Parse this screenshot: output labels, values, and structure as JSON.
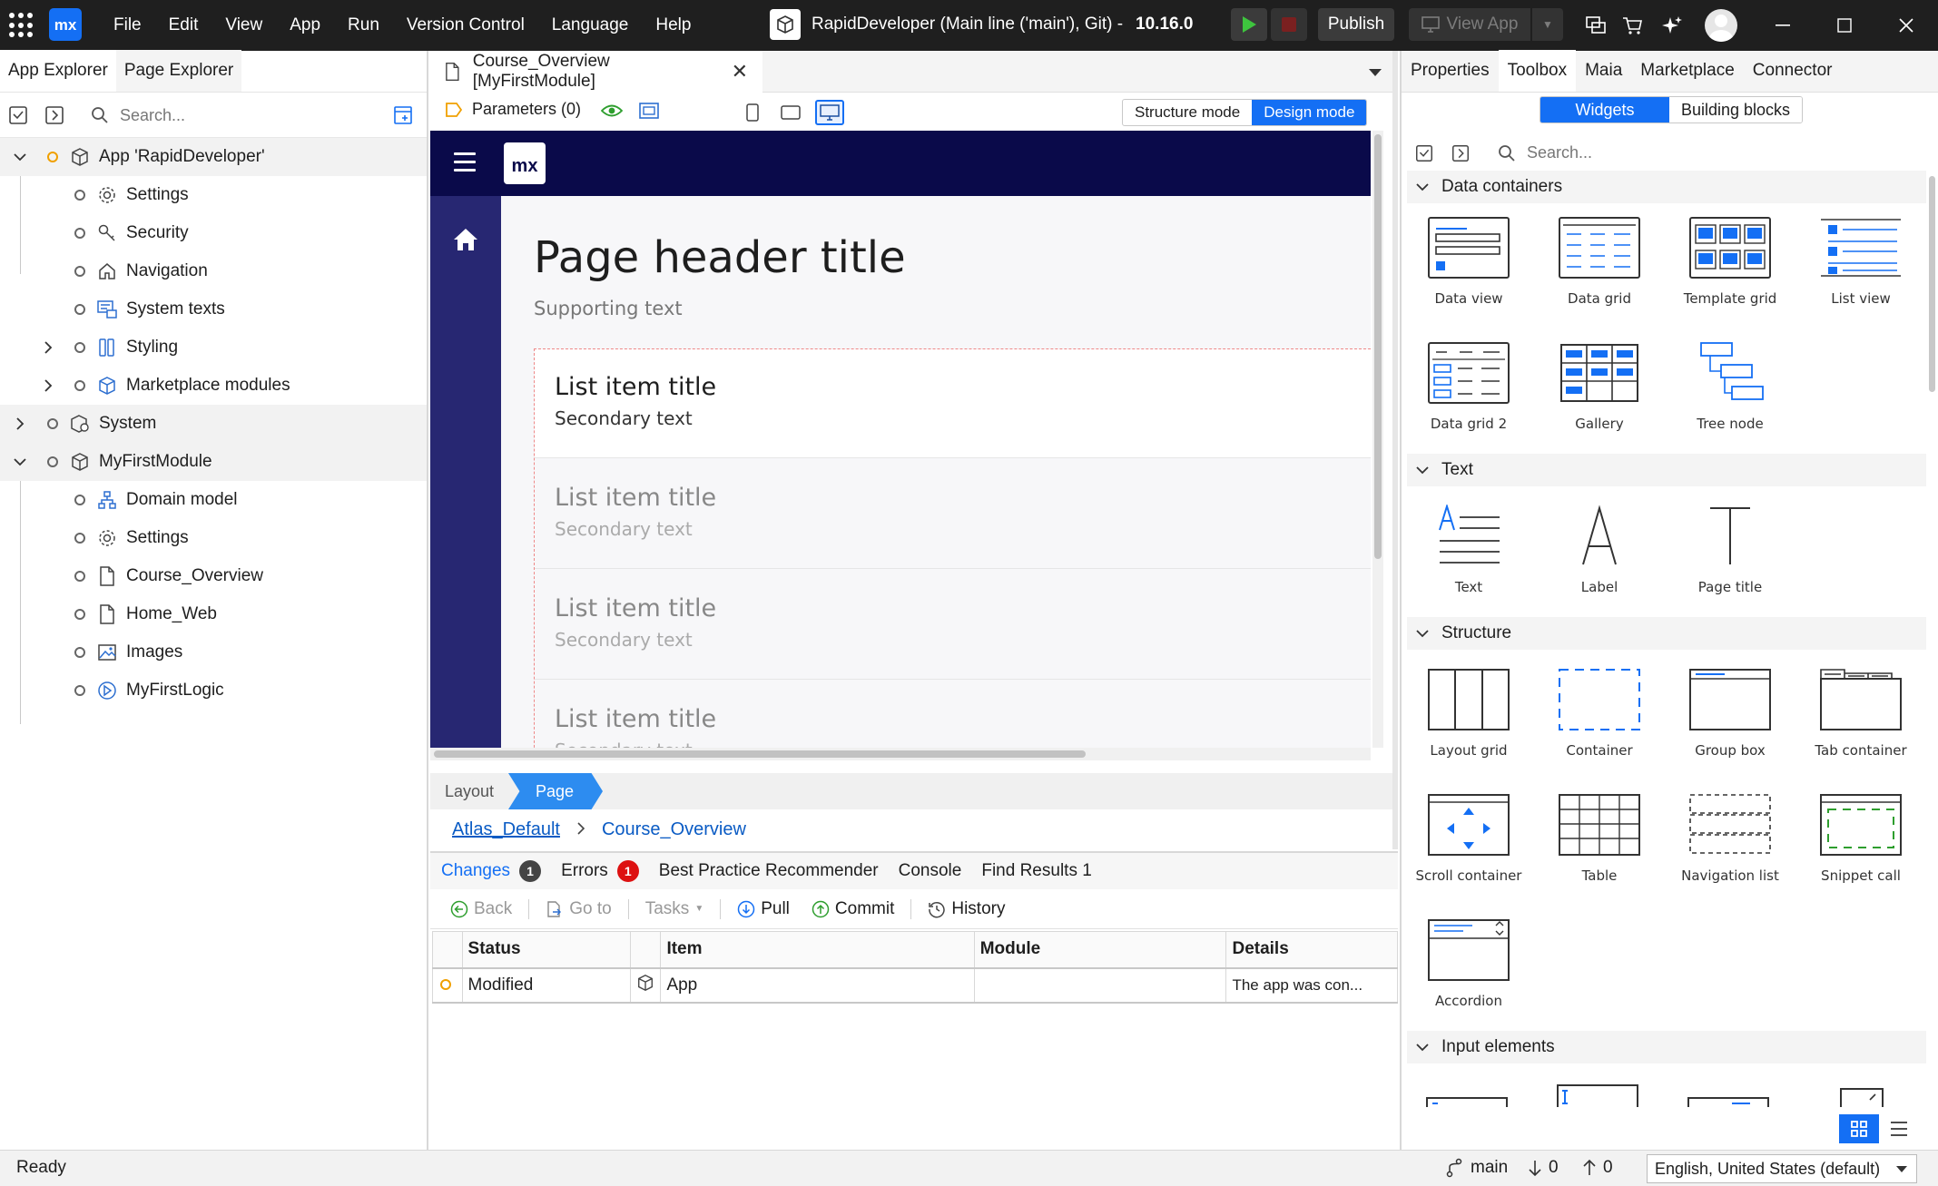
{
  "titlebar": {
    "menu": [
      "File",
      "Edit",
      "View",
      "App",
      "Run",
      "Version Control",
      "Language",
      "Help"
    ],
    "app_title": "RapidDeveloper (Main line ('main'), Git)  -",
    "version": "10.16.0",
    "publish_label": "Publish",
    "view_app_label": "View App",
    "logo_text": "mx"
  },
  "left_panel": {
    "tabs": [
      "App Explorer",
      "Page Explorer"
    ],
    "search_placeholder": "Search...",
    "tree": [
      {
        "label": "App 'RapidDeveloper'",
        "icon": "app-cube-icon"
      },
      {
        "label": "Settings",
        "icon": "gear-icon"
      },
      {
        "label": "Security",
        "icon": "key-icon"
      },
      {
        "label": "Navigation",
        "icon": "home-icon"
      },
      {
        "label": "System texts",
        "icon": "system-texts-icon"
      },
      {
        "label": "Styling",
        "icon": "styling-icon"
      },
      {
        "label": "Marketplace modules",
        "icon": "marketplace-modules-icon"
      },
      {
        "label": "System",
        "icon": "system-module-icon"
      },
      {
        "label": "MyFirstModule",
        "icon": "module-icon"
      },
      {
        "label": "Domain model",
        "icon": "domain-model-icon"
      },
      {
        "label": "Settings",
        "icon": "gear-icon"
      },
      {
        "label": "Course_Overview",
        "icon": "page-icon"
      },
      {
        "label": "Home_Web",
        "icon": "page-icon"
      },
      {
        "label": "Images",
        "icon": "images-icon"
      },
      {
        "label": "MyFirstLogic",
        "icon": "microflow-icon"
      }
    ]
  },
  "editor": {
    "tab_title": "Course_Overview [MyFirstModule]",
    "parameters_label": "Parameters (0)",
    "structure_mode": "Structure mode",
    "design_mode": "Design mode",
    "canvas": {
      "logo_text": "mx",
      "header_title": "Page header title",
      "supporting_text": "Supporting text",
      "list_items": [
        {
          "title": "List item title",
          "secondary": "Secondary text"
        },
        {
          "title": "List item title",
          "secondary": "Secondary text"
        },
        {
          "title": "List item title",
          "secondary": "Secondary text"
        },
        {
          "title": "List item title",
          "secondary": "Secondary text"
        }
      ]
    },
    "crumb_layout": "Layout",
    "crumb_page": "Page",
    "path_layout": "Atlas_Default",
    "path_page": "Course_Overview"
  },
  "bottom_panel": {
    "tabs": {
      "changes": "Changes",
      "changes_count": "1",
      "errors": "Errors",
      "errors_count": "1",
      "bpr": "Best Practice Recommender",
      "console": "Console",
      "find": "Find Results 1"
    },
    "toolbar": {
      "back": "Back",
      "goto": "Go to",
      "tasks": "Tasks",
      "pull": "Pull",
      "commit": "Commit",
      "history": "History"
    },
    "columns": [
      "Status",
      "",
      "Item",
      "Module",
      "Details"
    ],
    "rows": [
      {
        "status": "Modified",
        "item": "App",
        "module": "",
        "details": "The app was con..."
      }
    ]
  },
  "right_panel": {
    "tabs": [
      "Properties",
      "Toolbox",
      "Maia",
      "Marketplace",
      "Connector"
    ],
    "seg_widgets": "Widgets",
    "seg_blocks": "Building blocks",
    "search_placeholder": "Search...",
    "categories": {
      "data": "Data containers",
      "text": "Text",
      "structure": "Structure",
      "input": "Input elements"
    },
    "widgets": {
      "data": [
        "Data view",
        "Data grid",
        "Template grid",
        "List view",
        "Data grid 2",
        "Gallery",
        "Tree node"
      ],
      "text": [
        "Text",
        "Label",
        "Page title"
      ],
      "structure": [
        "Layout grid",
        "Container",
        "Group box",
        "Tab container",
        "Scroll container",
        "Table",
        "Navigation list",
        "Snippet call",
        "Accordion"
      ]
    }
  },
  "statusbar": {
    "ready": "Ready",
    "branch": "main",
    "incoming": "0",
    "outgoing": "0",
    "language": "English, United States (default)"
  },
  "colors": {
    "accent": "#146ff4",
    "titlebar": "#1f1f1f",
    "canvas_topbar": "#0a0a4a",
    "canvas_sidebar": "#272772",
    "error_badge": "#dd1111",
    "modified_dot": "#f0a000"
  }
}
